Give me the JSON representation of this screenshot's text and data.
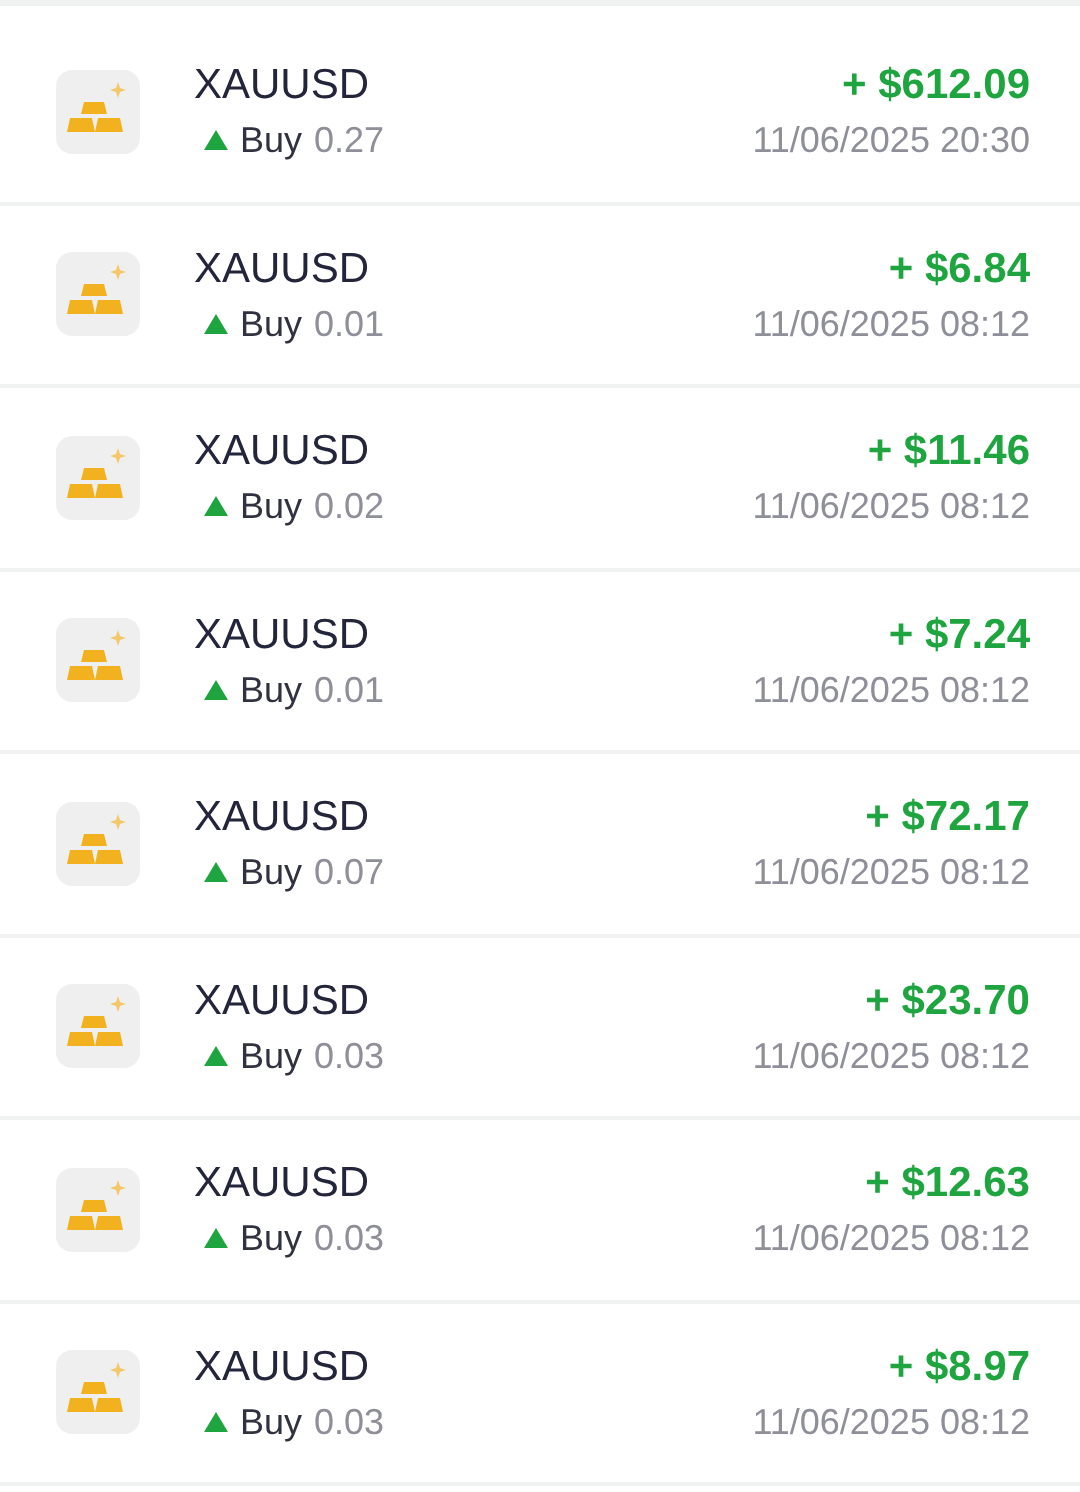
{
  "trades": [
    {
      "symbol": "XAUUSD",
      "kind": "buy",
      "side_label": "Buy",
      "volume": "0.27",
      "profit": "+ $612.09",
      "time": "11/06/2025 20:30"
    },
    {
      "symbol": "XAUUSD",
      "kind": "buy",
      "side_label": "Buy",
      "volume": "0.01",
      "profit": "+ $6.84",
      "time": "11/06/2025 08:12"
    },
    {
      "symbol": "XAUUSD",
      "kind": "buy",
      "side_label": "Buy",
      "volume": "0.02",
      "profit": "+ $11.46",
      "time": "11/06/2025 08:12"
    },
    {
      "symbol": "XAUUSD",
      "kind": "buy",
      "side_label": "Buy",
      "volume": "0.01",
      "profit": "+ $7.24",
      "time": "11/06/2025 08:12"
    },
    {
      "symbol": "XAUUSD",
      "kind": "buy",
      "side_label": "Buy",
      "volume": "0.07",
      "profit": "+ $72.17",
      "time": "11/06/2025 08:12"
    },
    {
      "symbol": "XAUUSD",
      "kind": "buy",
      "side_label": "Buy",
      "volume": "0.03",
      "profit": "+ $23.70",
      "time": "11/06/2025 08:12"
    },
    {
      "symbol": "XAUUSD",
      "kind": "buy",
      "side_label": "Buy",
      "volume": "0.03",
      "profit": "+ $12.63",
      "time": "11/06/2025 08:12"
    },
    {
      "symbol": "XAUUSD",
      "kind": "buy",
      "side_label": "Buy",
      "volume": "0.03",
      "profit": "+ $8.97",
      "time": "11/06/2025 08:12"
    }
  ]
}
